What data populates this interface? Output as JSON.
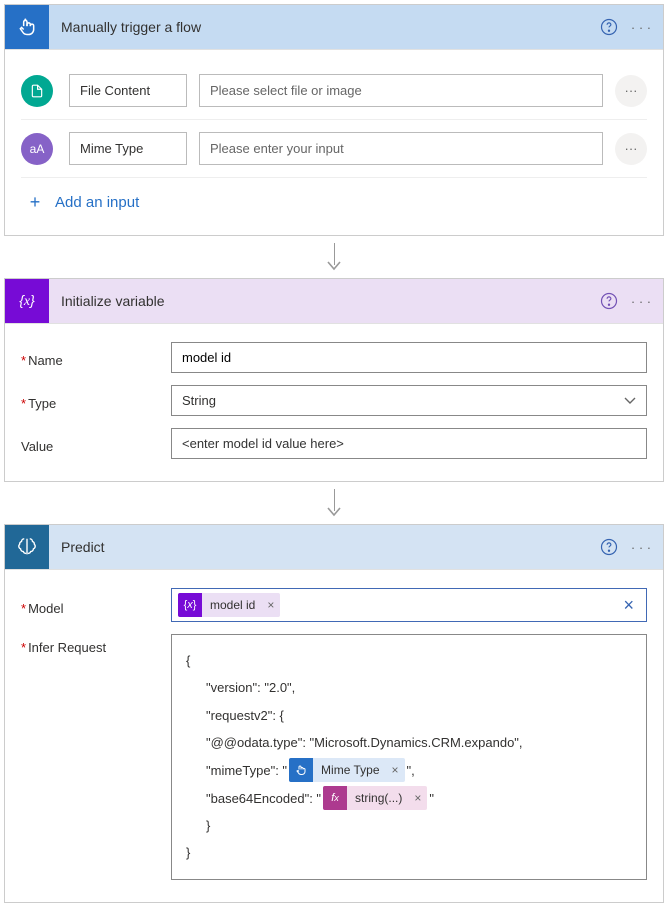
{
  "trigger": {
    "title": "Manually trigger a flow",
    "rows": [
      {
        "label": "File Content",
        "placeholder": "Please select file or image"
      },
      {
        "label": "Mime Type",
        "placeholder": "Please enter your input"
      }
    ],
    "add_input": "Add an input"
  },
  "variable": {
    "title": "Initialize variable",
    "name_label": "Name",
    "name_value": "model id",
    "type_label": "Type",
    "type_value": "String",
    "value_label": "Value",
    "value_placeholder": "<enter model id value here>"
  },
  "predict": {
    "title": "Predict",
    "model_label": "Model",
    "model_token": "model id",
    "infer_label": "Infer Request",
    "code": {
      "open": "{",
      "version": "\"version\": \"2.0\",",
      "requestv2": "\"requestv2\": {",
      "odata": "\"@@odata.type\": \"Microsoft.Dynamics.CRM.expando\",",
      "mime_pre": "\"mimeType\": \"",
      "mime_token": "Mime Type",
      "mime_post": "\",",
      "b64_pre": "\"base64Encoded\": \"",
      "b64_token": "string(...)",
      "b64_post": "\"",
      "close1": "}",
      "close2": "}"
    }
  }
}
